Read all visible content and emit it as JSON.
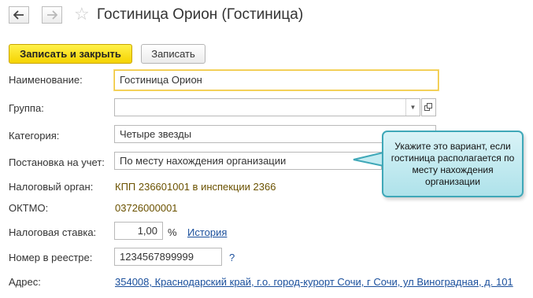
{
  "window": {
    "title": "Гостиница Орион (Гостиница)",
    "back_icon": "arrow-left-icon",
    "forward_icon": "arrow-right-icon",
    "favorite_icon": "star-icon"
  },
  "toolbar": {
    "save_close_label": "Записать и закрыть",
    "save_label": "Записать"
  },
  "form": {
    "name": {
      "label": "Наименование:",
      "value": "Гостиница Орион"
    },
    "group": {
      "label": "Группа:",
      "value": ""
    },
    "category": {
      "label": "Категория:",
      "value": "Четыре звезды"
    },
    "registration": {
      "label": "Постановка на учет:",
      "value": "По месту нахождения организации"
    },
    "tax_authority": {
      "label": "Налоговый орган:",
      "value": "КПП 236601001 в инспекции 2366"
    },
    "oktmo": {
      "label": "ОКТМО:",
      "value": "03726000001"
    },
    "tax_rate": {
      "label": "Налоговая ставка:",
      "value": "1,00",
      "unit": "%",
      "history_link": "История"
    },
    "registry_number": {
      "label": "Номер в реестре:",
      "value": "1234567899999",
      "help": "?"
    },
    "address": {
      "label": "Адрес:",
      "value": "354008, Краснодарский край, г.о. город-курорт Сочи, г Сочи, ул Виноградная, д. 101"
    }
  },
  "callout": {
    "text": "Укажите это вариант, если гостиница располагается по месту нахождения организации"
  },
  "colors": {
    "primary_button": "#f5d300",
    "link": "#1a4f9c",
    "readonly_text": "#6b5200",
    "callout_border": "#3fa8b8",
    "callout_fill": "#c4ecf2"
  }
}
